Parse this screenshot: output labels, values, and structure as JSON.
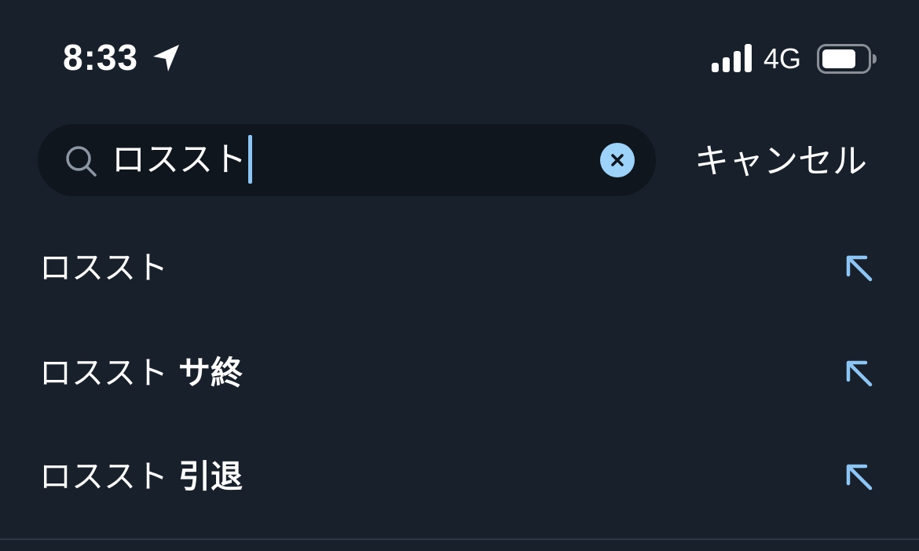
{
  "status_bar": {
    "time": "8:33",
    "network": "4G",
    "icons": [
      "location-arrow-icon",
      "signal-bars-icon",
      "battery-icon"
    ]
  },
  "search": {
    "value": "ロススト",
    "clear_icon": "clear-x-icon",
    "search_icon": "magnifier-icon",
    "cancel_label": "キャンセル"
  },
  "suggestions": [
    {
      "prefix": "ロススト",
      "suffix": "",
      "icon": "arrow-up-left-icon"
    },
    {
      "prefix": "ロススト",
      "suffix": "サ終",
      "icon": "arrow-up-left-icon"
    },
    {
      "prefix": "ロススト",
      "suffix": "引退",
      "icon": "arrow-up-left-icon"
    }
  ],
  "colors": {
    "background": "#17202b",
    "search_field": "#10161d",
    "accent": "#8dc6f5",
    "text": "#ffffff"
  }
}
